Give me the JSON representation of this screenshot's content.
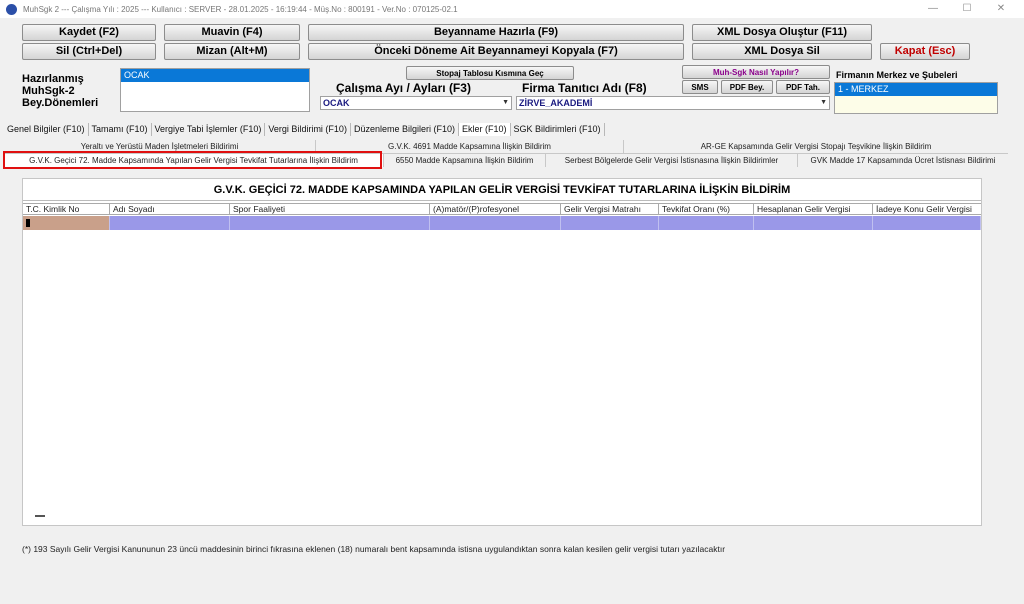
{
  "window": {
    "title": "MuhSgk 2  ---  Çalışma Yılı : 2025  ---  Kullanıcı : SERVER - 28.01.2025 - 16:19:44 - Müş.No : 800191 - Ver.No : 070125-02.1",
    "minimize": "—",
    "maximize": "☐",
    "close": "✕"
  },
  "toolbar": {
    "save": "Kaydet (F2)",
    "muavin": "Muavin (F4)",
    "beyanname": "Beyanname Hazırla (F9)",
    "xml_create": "XML Dosya Oluştur (F11)",
    "delete": "Sil (Ctrl+Del)",
    "mizan": "Mizan (Alt+M)",
    "copy_prev": "Önceki Döneme Ait Beyannameyi Kopyala (F7)",
    "xml_delete": "XML Dosya Sil",
    "exit": "Kapat (Esc)"
  },
  "left_panel": {
    "label_line1": "Hazırlanmış",
    "label_line2": "MuhSgk-2",
    "label_line3": "Bey.Dönemleri",
    "selected_period": "OCAK"
  },
  "middle": {
    "stopaj_button": "Stopaj Tablosu Kısmına Geç",
    "period_label": "Çalışma Ayı / Ayları (F3)",
    "period_value": "OCAK",
    "firm_label": "Firma Tanıtıcı Adı (F8)",
    "firm_value": "ZİRVE_AKADEMİ",
    "help_button": "Muh-Sgk Nasıl Yapılır?",
    "sms_button": "SMS",
    "pdf_bey_button": "PDF Bey.",
    "pdf_tah_button": "PDF Tah."
  },
  "right_panel": {
    "label": "Firmanın Merkez ve Şubeleri",
    "selected_branch": "1 - MERKEZ"
  },
  "main_tabs": [
    "Genel Bilgiler (F10)",
    "Tamamı (F10)",
    "Vergiye Tabi İşlemler (F10)",
    "Vergi Bildirimi (F10)",
    "Düzenleme Bilgileri (F10)",
    "Ekler (F10)",
    "SGK Bildirimleri (F10)"
  ],
  "sub_tabs_row1": [
    "Yeraltı ve Yerüstü Maden İşletmeleri Bildirimi",
    "G.V.K. 4691 Madde Kapsamına İlişkin Bildirim",
    "AR-GE Kapsamında Gelir Vergisi Stopajı Teşvikine İlişkin Bildirim"
  ],
  "sub_tabs_row2": [
    "G.V.K. Geçici 72. Madde Kapsamında Yapılan Gelir Vergisi Tevkifat Tutarlarına İlişkin Bildirim",
    "6550 Madde Kapsamına İlişkin Bildirim",
    "Serbest Bölgelerde Gelir Vergisi İstisnasına İlişkin Bildirimler",
    "GVK Madde 17 Kapsamında Ücret İstisnası Bildirimi"
  ],
  "panel": {
    "title": "G.V.K. GEÇİCİ 72. MADDE KAPSAMINDA YAPILAN GELİR VERGİSİ TEVKİFAT TUTARLARINA İLİŞKİN BİLDİRİM",
    "columns": [
      "T.C. Kimlik No",
      "Adı Soyadı",
      "Spor Faaliyeti",
      "(A)matör/(P)rofesyonel",
      "Gelir Vergisi Matrahı",
      "Tevkifat Oranı (%)",
      "Hesaplanan Gelir Vergisi",
      "İadeye Konu Gelir Vergisi"
    ]
  },
  "footnote": "(*) 193 Sayılı Gelir Vergisi Kanununun 23 üncü maddesinin birinci fıkrasına eklenen (18) numaralı bent kapsamında istisna uygulandıktan sonra kalan kesilen gelir vergisi tutarı yazılacaktır",
  "colors": {
    "selection_blue": "#0a78d7",
    "highlight_red": "#e01010",
    "grid_row": "#9a98e8",
    "exit_text": "#c00000"
  }
}
